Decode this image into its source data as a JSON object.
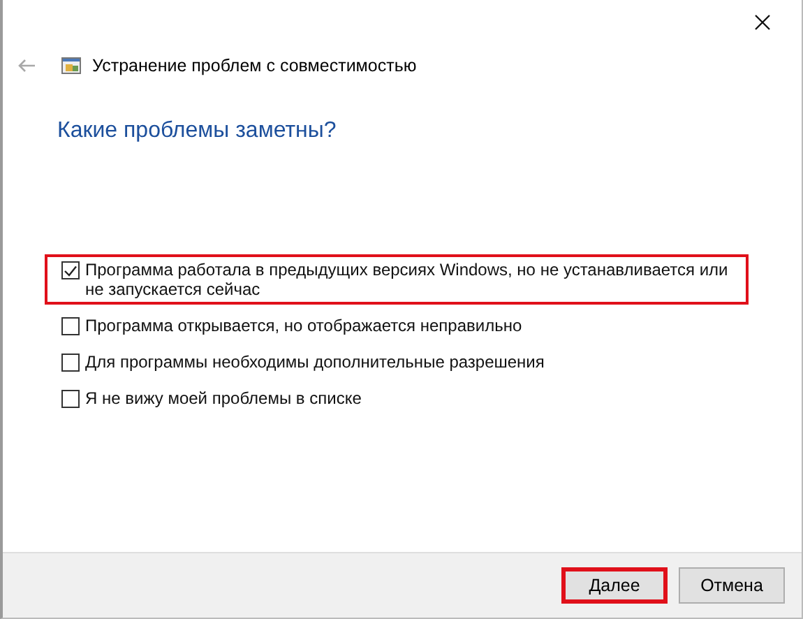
{
  "window": {
    "title": "Устранение проблем с совместимостью"
  },
  "heading": "Какие проблемы заметны?",
  "options": [
    {
      "label": "Программа работала в предыдущих версиях Windows, но не устанавливается или не запускается сейчас",
      "checked": true,
      "highlighted": true
    },
    {
      "label": "Программа открывается, но отображается неправильно",
      "checked": false,
      "highlighted": false
    },
    {
      "label": "Для программы необходимы дополнительные разрешения",
      "checked": false,
      "highlighted": false
    },
    {
      "label": "Я не вижу моей проблемы в списке",
      "checked": false,
      "highlighted": false
    }
  ],
  "buttons": [
    {
      "label": "Далее",
      "highlighted": true
    },
    {
      "label": "Отмена",
      "highlighted": false
    }
  ]
}
